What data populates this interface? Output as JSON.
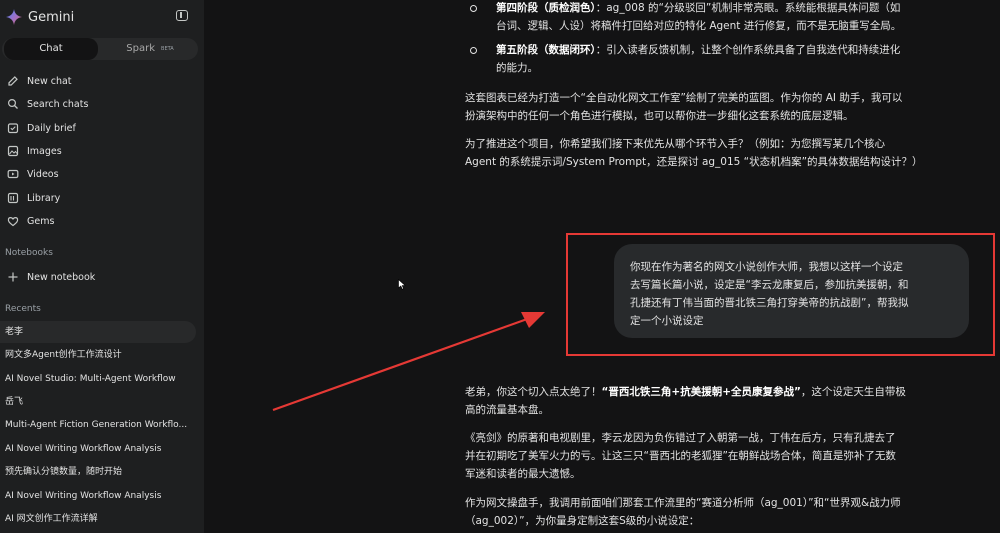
{
  "sidebar": {
    "app_title": "Gemini",
    "tabs": {
      "chat": "Chat",
      "spark": "Spark",
      "spark_badge": "BETA"
    },
    "nav": [
      {
        "label": "New chat",
        "icon": "edit-icon"
      },
      {
        "label": "Search chats",
        "icon": "search-icon"
      },
      {
        "label": "Daily brief",
        "icon": "brief-icon"
      },
      {
        "label": "Images",
        "icon": "image-icon"
      },
      {
        "label": "Videos",
        "icon": "video-icon"
      },
      {
        "label": "Library",
        "icon": "library-icon"
      },
      {
        "label": "Gems",
        "icon": "gem-icon"
      }
    ],
    "notebooks_heading": "Notebooks",
    "new_notebook": "New notebook",
    "recents_heading": "Recents",
    "recents": [
      "老李",
      "网文多Agent创作工作流设计",
      "AI Novel Studio: Multi-Agent Workflow",
      "岳飞",
      "Multi-Agent Fiction Generation Workflo...",
      "AI Novel Writing Workflow Analysis",
      "预先确认分镜数量，随时开始",
      "AI Novel Writing Workflow Analysis",
      "AI 网文创作工作流详解"
    ]
  },
  "response_top": {
    "stage4_label": "第四阶段（质检润色）",
    "stage4_line1": "：ag_008 的“分级驳回”机制非常亮眼。系统能根据具体问题（如",
    "stage4_line2": "台词、逻辑、人设）将稿件打回给对应的特化 Agent 进行修复，而不是无脑重写全局。",
    "stage5_label": "第五阶段（数据闭环）",
    "stage5_line1": "：引入读者反馈机制，让整个创作系统具备了自我迭代和持续进化",
    "stage5_line2": "的能力。",
    "para1_line1": "这套图表已经为打造一个“全自动化网文工作室”绘制了完美的蓝图。作为你的 AI 助手，我可以",
    "para1_line2": "扮演架构中的任何一个角色进行模拟，也可以帮你进一步细化这套系统的底层逻辑。",
    "para2_line1": "为了推进这个项目，你希望我们接下来优先从哪个环节入手？（例如：为您撰写某几个核心",
    "para2_line2": "Agent 的系统提示词/System Prompt，还是探讨 ag_015 “状态机档案”的具体数据结构设计？）"
  },
  "user_message": {
    "line1": "你现在作为著名的网文小说创作大师，我想以这样一个设定",
    "line2": "去写篇长篇小说，设定是“李云龙康复后，参加抗美援朝，和",
    "line3": "孔捷还有丁伟当面的晋北铁三角打穿美帝的抗战剧”，帮我拟",
    "line4": "定一个小说设定"
  },
  "response_bottom": {
    "p1_start": "老弟，你这个切入点太绝了！",
    "p1_bold": "“晋西北铁三角+抗美援朝+全员康复参战”",
    "p1_end": "，这个设定天生自带极",
    "p1_line2": "高的流量基本盘。",
    "p2_line1": "《亮剑》的原著和电视剧里，李云龙因为负伤错过了入朝第一战，丁伟在后方，只有孔捷去了",
    "p2_line2": "并在初期吃了美军火力的亏。让这三只“晋西北的老狐狸”在朝鲜战场合体，简直是弥补了无数",
    "p2_line3": "军迷和读者的最大遗憾。",
    "p3_line1": "作为网文操盘手，我调用前面咱们那套工作流里的“赛道分析师（ag_001）”和“世界观&战力师",
    "p3_line2": "（ag_002）”，为你量身定制这套S级的小说设定："
  },
  "colors": {
    "highlight": "#e53935",
    "background": "#131314",
    "sidebar": "#1e1f20"
  }
}
